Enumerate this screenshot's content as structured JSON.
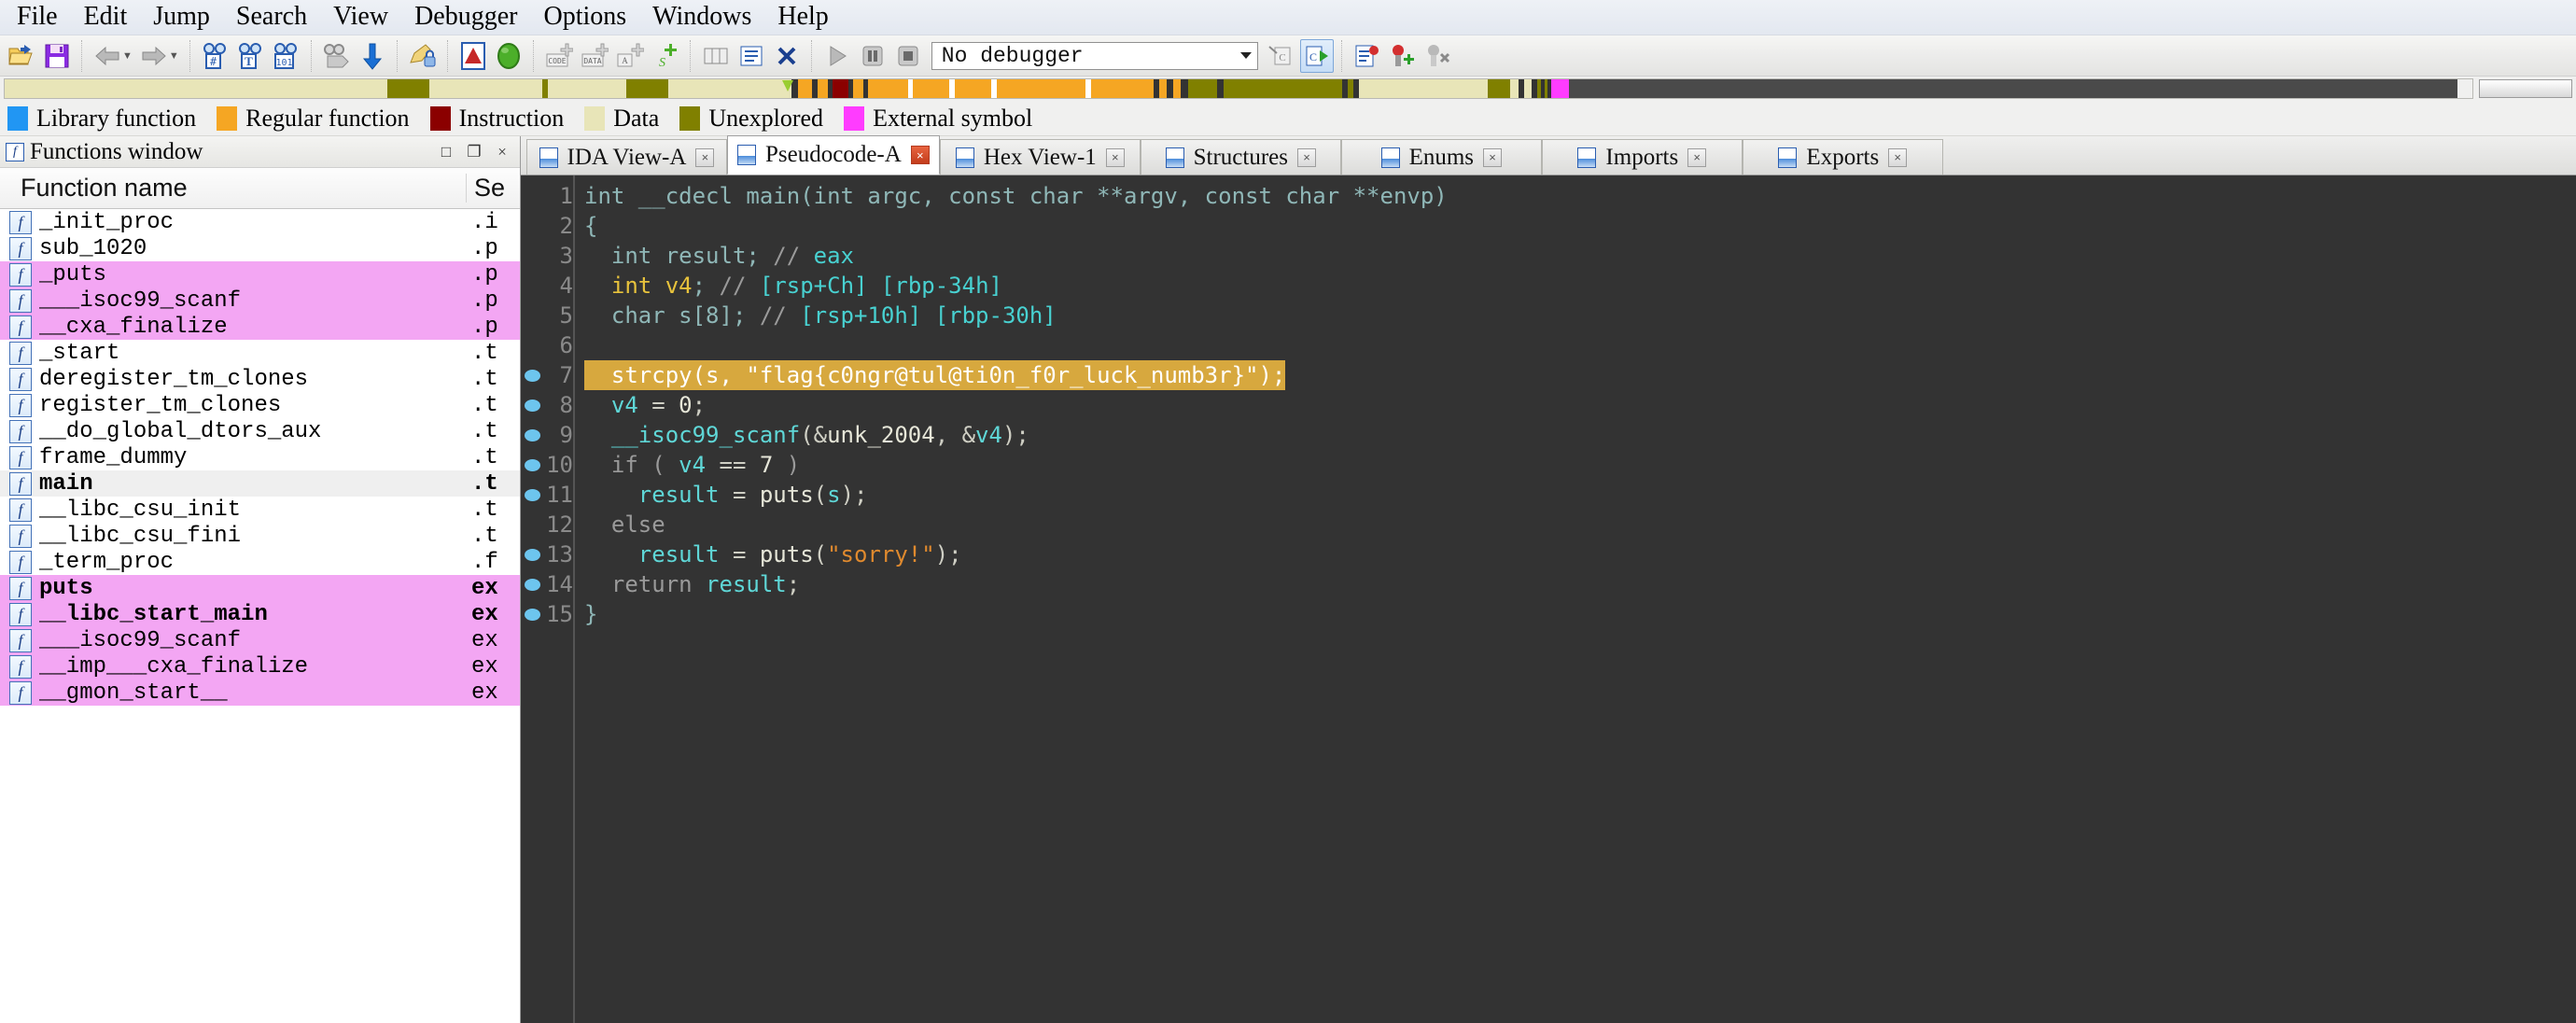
{
  "menubar": {
    "items": [
      "File",
      "Edit",
      "Jump",
      "Search",
      "View",
      "Debugger",
      "Options",
      "Windows",
      "Help"
    ]
  },
  "toolbar": {
    "buttons": [
      {
        "name": "open-file-icon",
        "glyph": "📂"
      },
      {
        "name": "save-file-icon",
        "glyph": "💾"
      },
      {
        "name": "navigate-back-icon",
        "glyph": "⬅"
      },
      {
        "name": "navigate-forward-icon",
        "glyph": "➡"
      },
      {
        "name": "search-hash-icon",
        "glyph": "🔍"
      },
      {
        "name": "search-text-icon",
        "glyph": "🔍"
      },
      {
        "name": "search-binary-icon",
        "glyph": "🔍"
      },
      {
        "name": "search-next-icon",
        "glyph": "🔎"
      },
      {
        "name": "jump-down-icon",
        "glyph": "⬇"
      },
      {
        "name": "edit-lock-icon",
        "glyph": "✎"
      },
      {
        "name": "warning-icon",
        "glyph": "⚠"
      },
      {
        "name": "green-status-icon",
        "glyph": "●"
      },
      {
        "name": "make-code-icon",
        "glyph": "CODE"
      },
      {
        "name": "make-data-icon",
        "glyph": "DATA"
      },
      {
        "name": "make-ascii-icon",
        "glyph": "A"
      },
      {
        "name": "make-struct-icon",
        "glyph": "S"
      },
      {
        "name": "make-array-icon",
        "glyph": "▦"
      },
      {
        "name": "undefine-icon",
        "glyph": "✖"
      }
    ],
    "debugger_value": "No debugger",
    "debugger_options": [
      "No debugger"
    ],
    "run_label": "▶",
    "pause_label": "❚❚",
    "stop_label": "■"
  },
  "navband": {
    "segments": [
      {
        "color": "#e8e5b8",
        "width": 15.5
      },
      {
        "color": "#808000",
        "width": 1.7
      },
      {
        "color": "#e8e5b8",
        "width": 4.6
      },
      {
        "color": "#808000",
        "width": 0.2
      },
      {
        "color": "#e8e5b8",
        "width": 3.2
      },
      {
        "color": "#808000",
        "width": 1.7
      },
      {
        "color": "#e8e5b8",
        "width": 5.0
      },
      {
        "color": "#333333",
        "width": 0.25
      },
      {
        "color": "#f5a623",
        "width": 0.55
      },
      {
        "color": "#333333",
        "width": 0.25
      },
      {
        "color": "#f5a623",
        "width": 0.4
      },
      {
        "color": "#333333",
        "width": 0.2
      },
      {
        "color": "#8b0000",
        "width": 0.65
      },
      {
        "color": "#333333",
        "width": 0.2
      },
      {
        "color": "#f5a623",
        "width": 0.4
      },
      {
        "color": "#333333",
        "width": 0.2
      },
      {
        "color": "#f5a623",
        "width": 1.6
      },
      {
        "color": "#ffffff",
        "width": 0.2
      },
      {
        "color": "#f5a623",
        "width": 1.5
      },
      {
        "color": "#ffffff",
        "width": 0.2
      },
      {
        "color": "#f5a623",
        "width": 1.5
      },
      {
        "color": "#ffffff",
        "width": 0.2
      },
      {
        "color": "#f5a623",
        "width": 3.6
      },
      {
        "color": "#ffffff",
        "width": 0.25
      },
      {
        "color": "#f5a623",
        "width": 2.5
      },
      {
        "color": "#333333",
        "width": 0.25
      },
      {
        "color": "#f5a623",
        "width": 0.3
      },
      {
        "color": "#333333",
        "width": 0.25
      },
      {
        "color": "#f5a623",
        "width": 0.3
      },
      {
        "color": "#333333",
        "width": 0.3
      },
      {
        "color": "#808000",
        "width": 1.2
      },
      {
        "color": "#333333",
        "width": 0.25
      },
      {
        "color": "#808000",
        "width": 4.8
      },
      {
        "color": "#333333",
        "width": 0.25
      },
      {
        "color": "#808000",
        "width": 0.2
      },
      {
        "color": "#333333",
        "width": 0.25
      },
      {
        "color": "#e8e5b8",
        "width": 5.2
      },
      {
        "color": "#808000",
        "width": 0.9
      },
      {
        "color": "#e8e5b8",
        "width": 0.35
      },
      {
        "color": "#333333",
        "width": 0.25
      },
      {
        "color": "#e8e5b8",
        "width": 0.3
      },
      {
        "color": "#333333",
        "width": 0.2
      },
      {
        "color": "#808000",
        "width": 0.15
      },
      {
        "color": "#333333",
        "width": 0.15
      },
      {
        "color": "#808000",
        "width": 0.15
      },
      {
        "color": "#333333",
        "width": 0.15
      },
      {
        "color": "#ff3cff",
        "width": 0.7
      },
      {
        "color": "#4a4a4a",
        "width": 36.0
      }
    ],
    "marker_position_pct": 31.5
  },
  "legend": {
    "entries": [
      {
        "label": "Library function",
        "color": "#2196f3"
      },
      {
        "label": "Regular function",
        "color": "#f5a623"
      },
      {
        "label": "Instruction",
        "color": "#8b0000"
      },
      {
        "label": "Data",
        "color": "#e8e5b8"
      },
      {
        "label": "Unexplored",
        "color": "#808000"
      },
      {
        "label": "External symbol",
        "color": "#ff3cff"
      }
    ]
  },
  "functions_window": {
    "title": "Functions window",
    "icon": "f",
    "window_buttons": [
      {
        "name": "maximize-button",
        "glyph": "□"
      },
      {
        "name": "float-button",
        "glyph": "❐"
      },
      {
        "name": "close-button",
        "glyph": "×"
      }
    ],
    "columns": [
      "Function name",
      "Se"
    ],
    "rows": [
      {
        "name": "_init_proc",
        "segment": ".i",
        "style": "normal"
      },
      {
        "name": "sub_1020",
        "segment": ".p",
        "style": "normal"
      },
      {
        "name": "_puts",
        "segment": ".p",
        "style": "external"
      },
      {
        "name": "___isoc99_scanf",
        "segment": ".p",
        "style": "external"
      },
      {
        "name": "__cxa_finalize",
        "segment": ".p",
        "style": "external"
      },
      {
        "name": "_start",
        "segment": ".t",
        "style": "normal"
      },
      {
        "name": "deregister_tm_clones",
        "segment": ".t",
        "style": "normal"
      },
      {
        "name": "register_tm_clones",
        "segment": ".t",
        "style": "normal"
      },
      {
        "name": "__do_global_dtors_aux",
        "segment": ".t",
        "style": "normal"
      },
      {
        "name": "frame_dummy",
        "segment": ".t",
        "style": "normal"
      },
      {
        "name": "main",
        "segment": ".t",
        "style": "selected"
      },
      {
        "name": "__libc_csu_init",
        "segment": ".t",
        "style": "normal"
      },
      {
        "name": "__libc_csu_fini",
        "segment": ".t",
        "style": "normal"
      },
      {
        "name": "_term_proc",
        "segment": ".f",
        "style": "normal"
      },
      {
        "name": "puts",
        "segment": "ex",
        "style": "external-bold"
      },
      {
        "name": "__libc_start_main",
        "segment": "ex",
        "style": "external-bold"
      },
      {
        "name": "___isoc99_scanf",
        "segment": "ex",
        "style": "external"
      },
      {
        "name": "__imp___cxa_finalize",
        "segment": "ex",
        "style": "external"
      },
      {
        "name": "__gmon_start__",
        "segment": "ex",
        "style": "external"
      }
    ]
  },
  "tabs": [
    {
      "label": "IDA View-A",
      "active": false
    },
    {
      "label": "Pseudocode-A",
      "active": true
    },
    {
      "label": "Hex View-1",
      "active": false
    },
    {
      "label": "Structures",
      "active": false
    },
    {
      "label": "Enums",
      "active": false
    },
    {
      "label": "Imports",
      "active": false
    },
    {
      "label": "Exports",
      "active": false
    }
  ],
  "pseudocode": {
    "flag": "flag{c0ngr@tul@ti0n_f0r_luck_numb3r}",
    "lines": [
      {
        "n": 1,
        "bp": false,
        "hl": false,
        "tokens": [
          {
            "t": "int __cdecl ",
            "c": "t-def"
          },
          {
            "t": "main",
            "c": "t-def"
          },
          {
            "t": "(int argc, const char **argv, const char **envp)",
            "c": "t-def"
          }
        ]
      },
      {
        "n": 2,
        "bp": false,
        "hl": false,
        "tokens": [
          {
            "t": "{",
            "c": "t-def"
          }
        ]
      },
      {
        "n": 3,
        "bp": false,
        "hl": false,
        "tokens": [
          {
            "t": "  int result; ",
            "c": "t-def"
          },
          {
            "t": "// ",
            "c": "t-cmt"
          },
          {
            "t": "eax",
            "c": "t-cmt2"
          }
        ]
      },
      {
        "n": 4,
        "bp": false,
        "hl": false,
        "tokens": [
          {
            "t": "  int",
            "c": "t-kw"
          },
          {
            "t": " v4",
            "c": "t-kw"
          },
          {
            "t": "; ",
            "c": "t-def"
          },
          {
            "t": "// ",
            "c": "t-cmt"
          },
          {
            "t": "[rsp+Ch] [rbp-34h]",
            "c": "t-cmt2"
          }
        ]
      },
      {
        "n": 5,
        "bp": false,
        "hl": false,
        "tokens": [
          {
            "t": "  char s[8]; ",
            "c": "t-def"
          },
          {
            "t": "// ",
            "c": "t-cmt"
          },
          {
            "t": "[rsp+10h] [rbp-30h]",
            "c": "t-cmt2"
          }
        ]
      },
      {
        "n": 6,
        "bp": false,
        "hl": false,
        "tokens": [
          {
            "t": "",
            "c": "t-def"
          }
        ]
      },
      {
        "n": 7,
        "bp": true,
        "hl": true,
        "tokens": [
          {
            "t": "  strcpy(s, \"flag{c0ngr@tul@ti0n_f0r_luck_numb3r}\");",
            "c": "t-def"
          }
        ]
      },
      {
        "n": 8,
        "bp": true,
        "hl": false,
        "tokens": [
          {
            "t": "  v4",
            "c": "t-var"
          },
          {
            "t": " = ",
            "c": "t-punct"
          },
          {
            "t": "0",
            "c": "t-num"
          },
          {
            "t": ";",
            "c": "t-punct"
          }
        ]
      },
      {
        "n": 9,
        "bp": true,
        "hl": false,
        "tokens": [
          {
            "t": "  __isoc99_scanf",
            "c": "t-var"
          },
          {
            "t": "(&",
            "c": "t-punct"
          },
          {
            "t": "unk_2004",
            "c": "t-fn"
          },
          {
            "t": ", &",
            "c": "t-punct"
          },
          {
            "t": "v4",
            "c": "t-var"
          },
          {
            "t": ");",
            "c": "t-punct"
          }
        ]
      },
      {
        "n": 10,
        "bp": true,
        "hl": false,
        "tokens": [
          {
            "t": "  if ( ",
            "c": "t-cmt"
          },
          {
            "t": "v4",
            "c": "t-var"
          },
          {
            "t": " == ",
            "c": "t-punct"
          },
          {
            "t": "7",
            "c": "t-num"
          },
          {
            "t": " )",
            "c": "t-cmt"
          }
        ]
      },
      {
        "n": 11,
        "bp": true,
        "hl": false,
        "tokens": [
          {
            "t": "    result",
            "c": "t-var"
          },
          {
            "t": " = ",
            "c": "t-punct"
          },
          {
            "t": "puts",
            "c": "t-fn"
          },
          {
            "t": "(",
            "c": "t-punct"
          },
          {
            "t": "s",
            "c": "t-var"
          },
          {
            "t": ");",
            "c": "t-punct"
          }
        ]
      },
      {
        "n": 12,
        "bp": false,
        "hl": false,
        "tokens": [
          {
            "t": "  else",
            "c": "t-cmt"
          }
        ]
      },
      {
        "n": 13,
        "bp": true,
        "hl": false,
        "tokens": [
          {
            "t": "    result",
            "c": "t-var"
          },
          {
            "t": " = ",
            "c": "t-punct"
          },
          {
            "t": "puts",
            "c": "t-fn"
          },
          {
            "t": "(",
            "c": "t-punct"
          },
          {
            "t": "\"sorry!\"",
            "c": "t-str"
          },
          {
            "t": ");",
            "c": "t-punct"
          }
        ]
      },
      {
        "n": 14,
        "bp": true,
        "hl": false,
        "tokens": [
          {
            "t": "  return ",
            "c": "t-cmt"
          },
          {
            "t": "result",
            "c": "t-var"
          },
          {
            "t": ";",
            "c": "t-punct"
          }
        ]
      },
      {
        "n": 15,
        "bp": true,
        "hl": false,
        "tokens": [
          {
            "t": "}",
            "c": "t-def"
          }
        ]
      }
    ]
  }
}
